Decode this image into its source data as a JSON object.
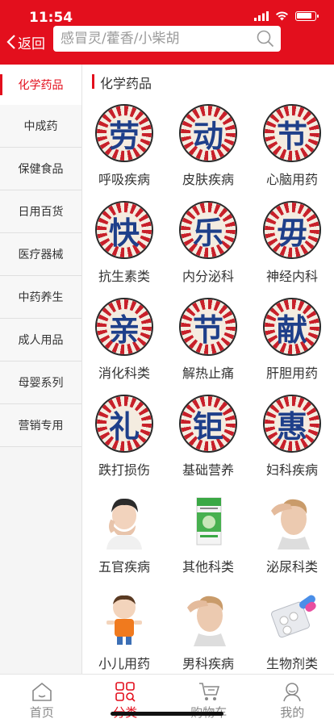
{
  "status": {
    "time": "11:54"
  },
  "header": {
    "back_label": "返回",
    "search_placeholder": "感冒灵/藿香/小柴胡"
  },
  "sidebar": {
    "items": [
      {
        "label": "化学药品",
        "active": true
      },
      {
        "label": "中成药"
      },
      {
        "label": "保健食品"
      },
      {
        "label": "日用百货"
      },
      {
        "label": "医疗器械"
      },
      {
        "label": "中药养生"
      },
      {
        "label": "成人用品"
      },
      {
        "label": "母婴系列"
      },
      {
        "label": "营销专用"
      }
    ]
  },
  "main": {
    "section_title": "化学药品",
    "categories": [
      {
        "label": "呼吸疾病",
        "badge": "劳"
      },
      {
        "label": "皮肤疾病",
        "badge": "动"
      },
      {
        "label": "心脑用药",
        "badge": "节"
      },
      {
        "label": "抗生素类",
        "badge": "快"
      },
      {
        "label": "内分泌科",
        "badge": "乐"
      },
      {
        "label": "神经内科",
        "badge": "毋"
      },
      {
        "label": "消化科类",
        "badge": "亲"
      },
      {
        "label": "解热止痛",
        "badge": "节"
      },
      {
        "label": "肝胆用药",
        "badge": "献"
      },
      {
        "label": "跌打损伤",
        "badge": "礼"
      },
      {
        "label": "基础营养",
        "badge": "钜"
      },
      {
        "label": "妇科疾病",
        "badge": "惠"
      },
      {
        "label": "五官疾病",
        "image": "child-crying-photo"
      },
      {
        "label": "其他科类",
        "image": "medicine-spray-box"
      },
      {
        "label": "泌尿科类",
        "image": "man-headache-photo"
      },
      {
        "label": "小儿用药",
        "image": "toddler-photo"
      },
      {
        "label": "男科疾病",
        "image": "man-headache-photo"
      },
      {
        "label": "生物剂类",
        "image": "capsule-blister-photo"
      }
    ]
  },
  "tabbar": {
    "items": [
      {
        "label": "首页",
        "icon": "home-icon"
      },
      {
        "label": "分类",
        "icon": "category-icon",
        "active": true
      },
      {
        "label": "购物车",
        "icon": "cart-icon"
      },
      {
        "label": "我的",
        "icon": "profile-icon"
      }
    ]
  },
  "colors": {
    "accent": "#e30f1d",
    "badge_red": "#c8202a",
    "badge_blue": "#1e3f8a"
  }
}
